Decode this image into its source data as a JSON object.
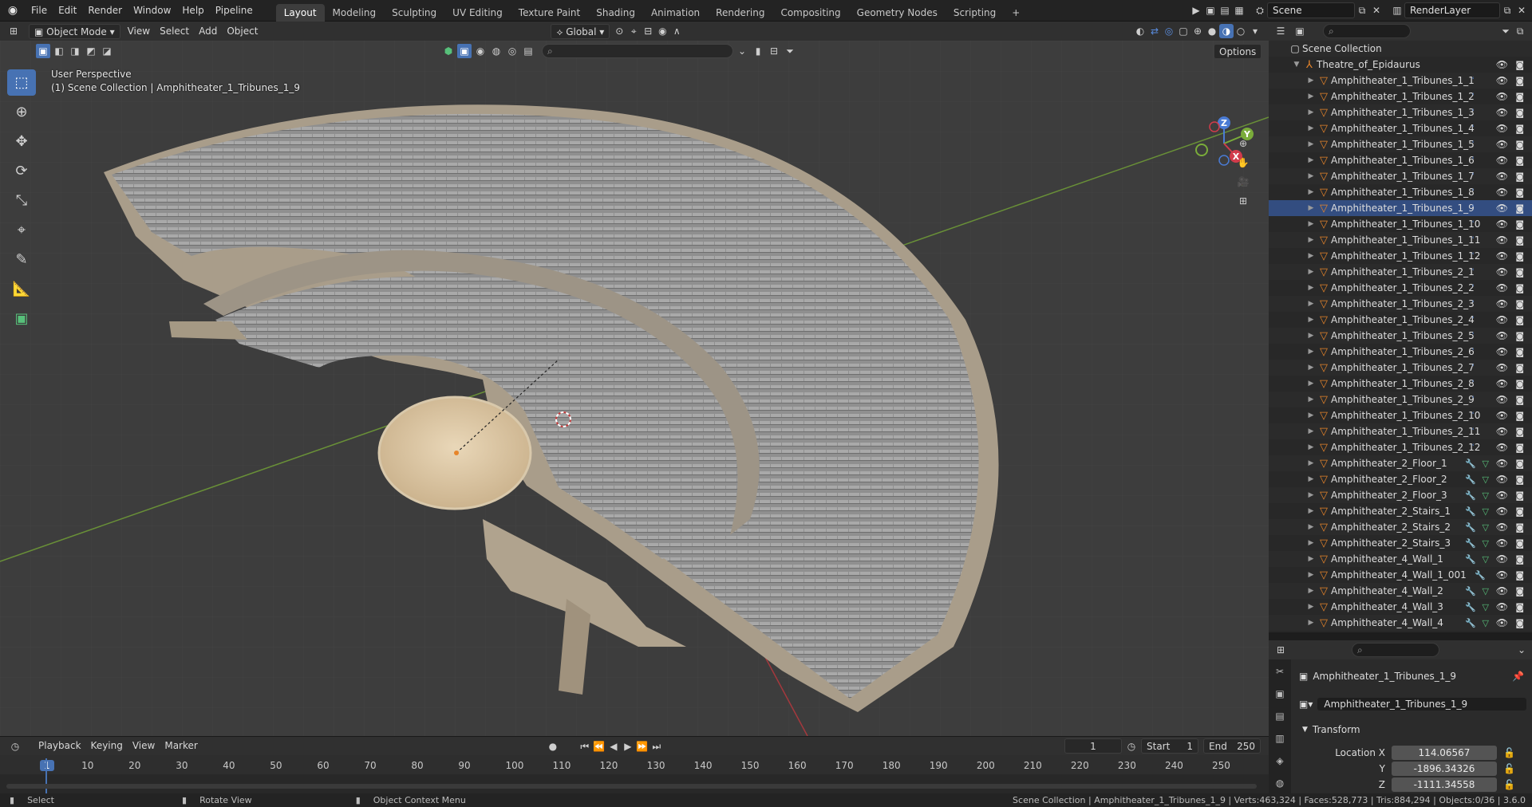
{
  "menubar": {
    "items": [
      "File",
      "Edit",
      "Render",
      "Window",
      "Help",
      "Pipeline"
    ],
    "workspaces": [
      "Layout",
      "Modeling",
      "Sculpting",
      "UV Editing",
      "Texture Paint",
      "Shading",
      "Animation",
      "Rendering",
      "Compositing",
      "Geometry Nodes",
      "Scripting"
    ],
    "active_workspace": "Layout",
    "add_tab": "+",
    "scene_name": "Scene",
    "view_layer": "RenderLayer"
  },
  "viewport_header": {
    "mode": "Object Mode",
    "menus": [
      "View",
      "Select",
      "Add",
      "Object"
    ],
    "transform_orientation": "Global",
    "options_label": "Options"
  },
  "viewport": {
    "perspective_label": "User Perspective",
    "context_label": "(1) Scene Collection | Amphitheater_1_Tribunes_1_9",
    "gizmo_axes": [
      "Z",
      "Y",
      "X"
    ]
  },
  "outliner": {
    "root": "Scene Collection",
    "collection": "Theatre_of_Epidaurus",
    "objects": [
      {
        "name": "Amphitheater_1_Tribunes_1_1",
        "kind": "tribune"
      },
      {
        "name": "Amphitheater_1_Tribunes_1_2",
        "kind": "tribune"
      },
      {
        "name": "Amphitheater_1_Tribunes_1_3",
        "kind": "tribune"
      },
      {
        "name": "Amphitheater_1_Tribunes_1_4",
        "kind": "tribune"
      },
      {
        "name": "Amphitheater_1_Tribunes_1_5",
        "kind": "tribune"
      },
      {
        "name": "Amphitheater_1_Tribunes_1_6",
        "kind": "tribune"
      },
      {
        "name": "Amphitheater_1_Tribunes_1_7",
        "kind": "tribune"
      },
      {
        "name": "Amphitheater_1_Tribunes_1_8",
        "kind": "tribune"
      },
      {
        "name": "Amphitheater_1_Tribunes_1_9",
        "kind": "tribune"
      },
      {
        "name": "Amphitheater_1_Tribunes_1_10",
        "kind": "tribune"
      },
      {
        "name": "Amphitheater_1_Tribunes_1_11",
        "kind": "tribune"
      },
      {
        "name": "Amphitheater_1_Tribunes_1_12",
        "kind": "tribune"
      },
      {
        "name": "Amphitheater_1_Tribunes_2_1",
        "kind": "tribune"
      },
      {
        "name": "Amphitheater_1_Tribunes_2_2",
        "kind": "tribune"
      },
      {
        "name": "Amphitheater_1_Tribunes_2_3",
        "kind": "tribune"
      },
      {
        "name": "Amphitheater_1_Tribunes_2_4",
        "kind": "tribune"
      },
      {
        "name": "Amphitheater_1_Tribunes_2_5",
        "kind": "tribune"
      },
      {
        "name": "Amphitheater_1_Tribunes_2_6",
        "kind": "tribune"
      },
      {
        "name": "Amphitheater_1_Tribunes_2_7",
        "kind": "tribune"
      },
      {
        "name": "Amphitheater_1_Tribunes_2_8",
        "kind": "tribune"
      },
      {
        "name": "Amphitheater_1_Tribunes_2_9",
        "kind": "tribune"
      },
      {
        "name": "Amphitheater_1_Tribunes_2_10",
        "kind": "tribune"
      },
      {
        "name": "Amphitheater_1_Tribunes_2_11",
        "kind": "tribune"
      },
      {
        "name": "Amphitheater_1_Tribunes_2_12",
        "kind": "tribune"
      },
      {
        "name": "Amphitheater_2_Floor_1",
        "kind": "mod"
      },
      {
        "name": "Amphitheater_2_Floor_2",
        "kind": "mod"
      },
      {
        "name": "Amphitheater_2_Floor_3",
        "kind": "mod"
      },
      {
        "name": "Amphitheater_2_Stairs_1",
        "kind": "mod"
      },
      {
        "name": "Amphitheater_2_Stairs_2",
        "kind": "mod"
      },
      {
        "name": "Amphitheater_2_Stairs_3",
        "kind": "mod"
      },
      {
        "name": "Amphitheater_4_Wall_1",
        "kind": "mod"
      },
      {
        "name": "Amphitheater_4_Wall_1_001",
        "kind": "mod-only"
      },
      {
        "name": "Amphitheater_4_Wall_2",
        "kind": "mod"
      },
      {
        "name": "Amphitheater_4_Wall_3",
        "kind": "mod"
      },
      {
        "name": "Amphitheater_4_Wall_4",
        "kind": "mod"
      }
    ]
  },
  "properties": {
    "object_name": "Amphitheater_1_Tribunes_1_9",
    "data_name": "Amphitheater_1_Tribunes_1_9",
    "panel_title": "Transform",
    "location_label": "Location X",
    "y_label": "Y",
    "z_label": "Z",
    "location_x": "114.06567",
    "location_y": "-1896.34326",
    "location_z": "-1111.34558"
  },
  "timeline": {
    "menus": [
      "Playback",
      "Keying",
      "View",
      "Marker"
    ],
    "current_frame": "1",
    "start_label": "Start",
    "start_value": "1",
    "end_label": "End",
    "end_value": "250",
    "ticks": [
      "1",
      "10",
      "20",
      "30",
      "40",
      "50",
      "60",
      "70",
      "80",
      "90",
      "100",
      "110",
      "120",
      "130",
      "140",
      "150",
      "160",
      "170",
      "180",
      "190",
      "200",
      "210",
      "220",
      "230",
      "240",
      "250"
    ]
  },
  "statusbar": {
    "select": "Select",
    "rotate": "Rotate View",
    "context_menu": "Object Context Menu",
    "stats": "Scene Collection | Amphitheater_1_Tribunes_1_9 | Verts:463,324 | Faces:528,773 | Tris:884,294 | Objects:0/36 | 3.6.0"
  },
  "colors": {
    "accent": "#4772b3",
    "object_icon": "#e7852a",
    "modifier_icon": "#5a8de0",
    "mesh_icon": "#57c07a",
    "viewport_bg": "#3d3d3d"
  }
}
